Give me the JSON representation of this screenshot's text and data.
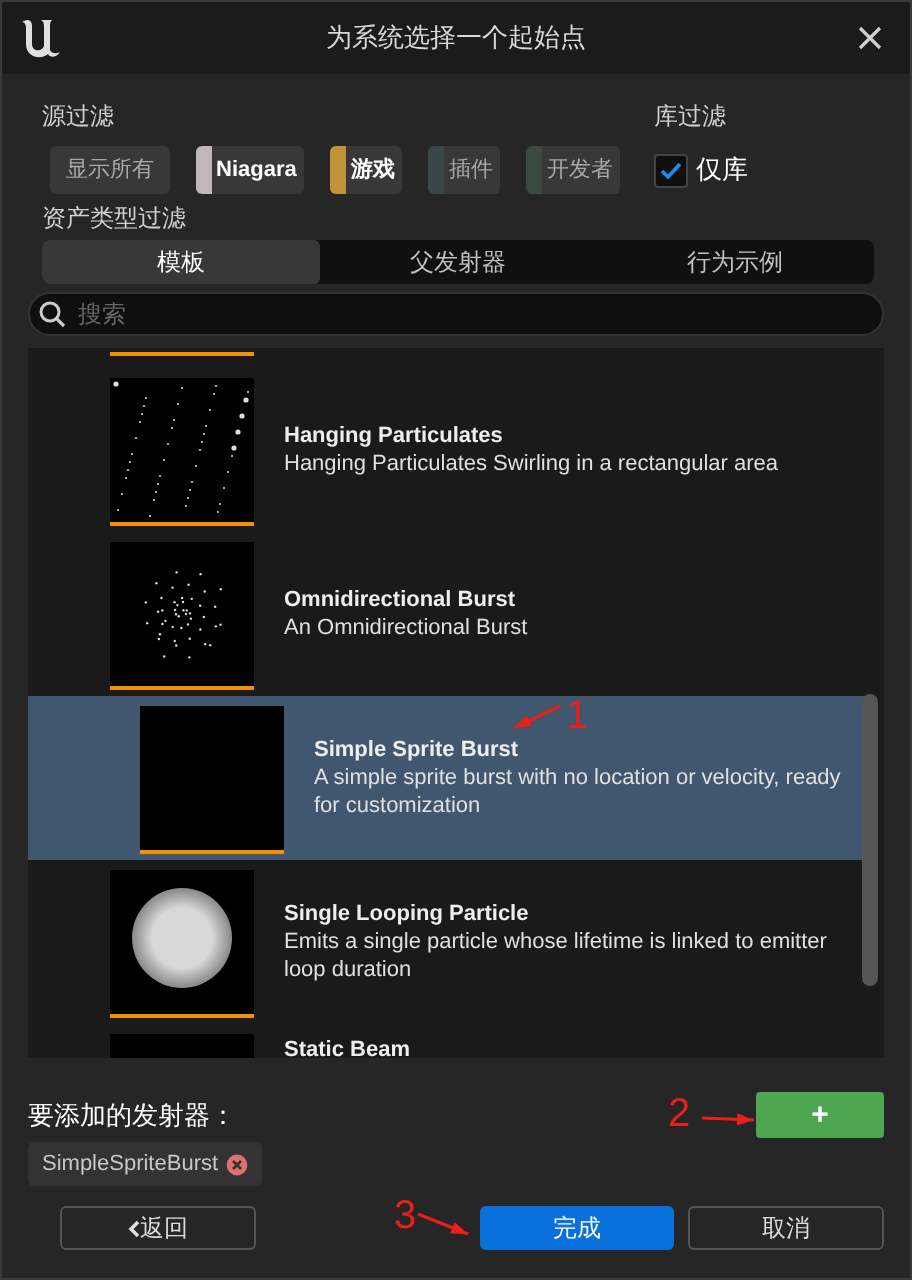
{
  "window": {
    "title": "为系统选择一个起始点"
  },
  "source_filter": {
    "label": "源过滤",
    "chips": [
      {
        "label": "显示所有",
        "selected": false
      },
      {
        "label": "Niagara",
        "selected": true,
        "color": "#c0b8b8"
      },
      {
        "label": "游戏",
        "selected": true,
        "color": "#c0953a"
      },
      {
        "label": "插件",
        "selected": false,
        "color": "#3a4748"
      },
      {
        "label": "开发者",
        "selected": false,
        "color": "#3a4a3e"
      }
    ]
  },
  "library_filter": {
    "label": "库过滤",
    "checkbox": {
      "label": "仅库",
      "checked": true
    }
  },
  "asset_type_filter": {
    "label": "资产类型过滤",
    "tabs": [
      {
        "label": "模板",
        "selected": true
      },
      {
        "label": "父发射器",
        "selected": false
      },
      {
        "label": "行为示例",
        "selected": false
      }
    ]
  },
  "search": {
    "placeholder": "搜索"
  },
  "emitters": [
    {
      "kind": "scatter",
      "title": "Hanging Particulates",
      "description": "Hanging Particulates Swirling in a rectangular area",
      "selected": false
    },
    {
      "kind": "burst",
      "title": "Omnidirectional Burst",
      "description": "An Omnidirectional Burst",
      "selected": false
    },
    {
      "kind": "empty",
      "title": "Simple Sprite Burst",
      "description": "A simple sprite burst with no location or velocity, ready for customization",
      "selected": true
    },
    {
      "kind": "sphere",
      "title": "Single Looping Particle",
      "description": "Emits a single particle whose lifetime is linked to emitter loop duration",
      "selected": false
    },
    {
      "kind": "empty",
      "title": "Static Beam",
      "selected": false
    }
  ],
  "emitters_to_add": {
    "label": "要添加的发射器：",
    "add_button": "+",
    "items": [
      "SimpleSpriteBurst"
    ]
  },
  "buttons": {
    "back": "返回",
    "finish": "完成",
    "cancel": "取消"
  },
  "annotations": [
    {
      "number": "1",
      "kind": "row"
    },
    {
      "number": "2",
      "kind": "add"
    },
    {
      "number": "3",
      "kind": "finish"
    }
  ]
}
